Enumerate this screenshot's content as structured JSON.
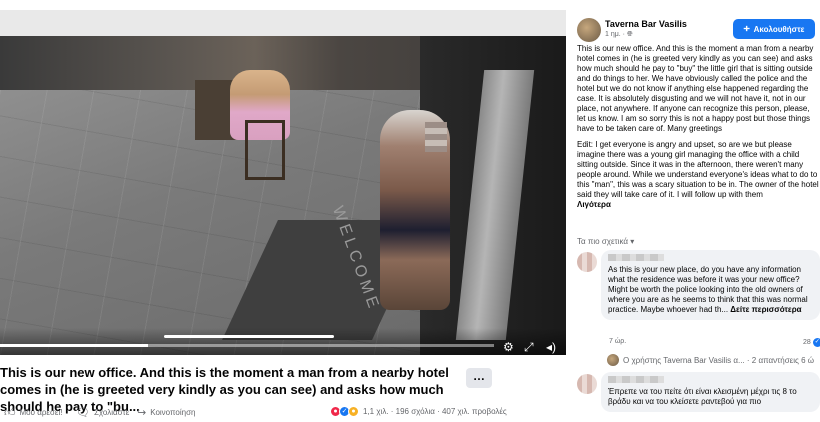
{
  "video": {
    "mat_text": "WELCOME",
    "progress_fraction": 0.3
  },
  "post": {
    "caption": "This is our new office. And this is the moment a man from a nearby hotel comes in (he is greeted very kindly as you can see) and asks how much should he pay to \"bu...",
    "more_label": "…",
    "actions": {
      "like": "Μου αρέσει!",
      "comment": "Σχολιάστε",
      "share": "Κοινοποίηση"
    },
    "stats": "1,1 χιλ. · 196 σχόλια · 407 χιλ. προβολές"
  },
  "panel": {
    "page_name": "Taverna Bar Vasilis",
    "time": "1 ημ. · ",
    "follow_label": "Ακολουθήστε",
    "body_p1": "This is our new office. And this is the moment a man from a nearby hotel comes in (he is greeted very kindly as you can see) and asks how much should he pay to \"buy\" the little girl that is sitting outside and do things to her. We have obviously called the police and the hotel but we do not know if anything else happened regarding the case. It is absolutely disgusting and we will not have it, not in our place, not anywhere. If anyone can recognize this person, please, let us know. I am so sorry this is not a happy post but those things have to be taken care of. Many greetings",
    "body_p2": "Edit: I get everyone is angry and upset, so are we but please imagine there was a young girl managing the office with a child sitting outside. Since it was in the afternoon, there weren't many people around. While we understand everyone's ideas what to do to this \"man\", this was a scary situation to be in. The owner of the hotel said they will take care of it. I will follow up with them",
    "more_link": "Λιγότερα",
    "relevant": "Τα πιο σχετικά ▾",
    "comments": [
      {
        "text": "As this is your new place, do you have any information what the residence was before it was your new office? Might be worth the police looking into the old owners of where you are as he seems to think that this was normal practice. Maybe whoever had th...",
        "see_more": "Δείτε περισσότερα",
        "age": "7 ώρ.",
        "likes": "28",
        "replies_text": "Ο χρήστης Taverna Bar Vasilis α... · 2 απαντήσεις 6 ώ"
      },
      {
        "text": "Έπρεπε να του πείτε ότι είναι κλεισμένη μέχρι τις 8 το βράδυ και να του κλείσετε ραντεβού για πιο"
      }
    ]
  }
}
